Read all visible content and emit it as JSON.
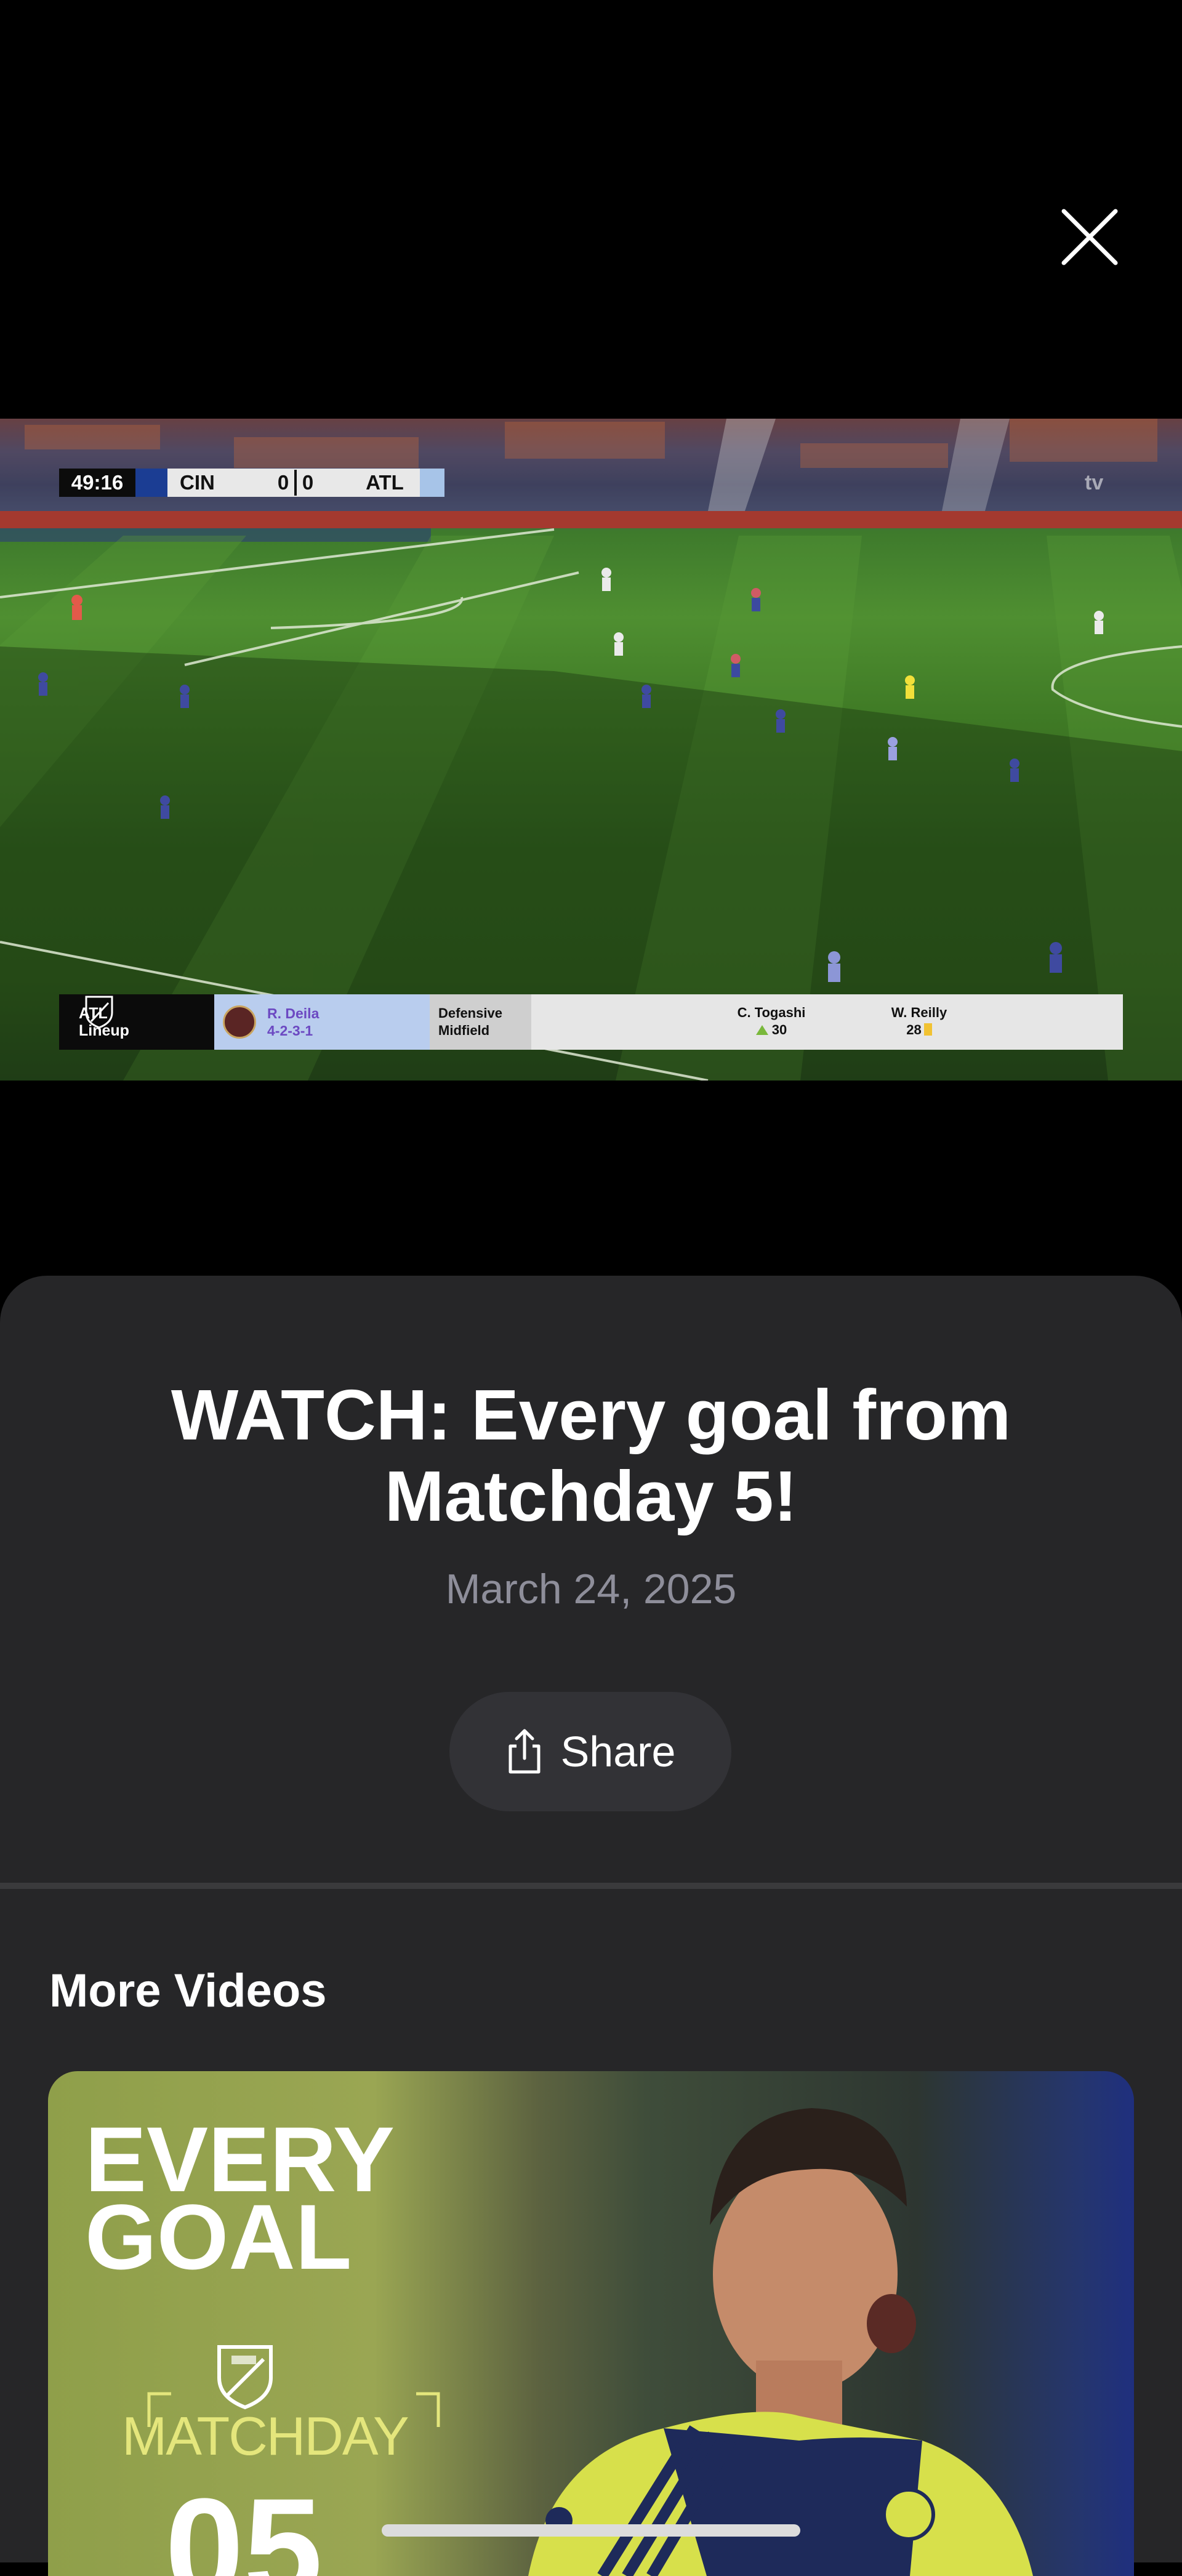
{
  "video": {
    "scoreboard": {
      "clock": "49:16",
      "home_team": "CIN",
      "home_score": "0",
      "away_score": "0",
      "away_team": "ATL"
    },
    "watermark": "tv",
    "lineup_graphic": {
      "title": "ATL\nLineup",
      "coach_name": "R. Deila",
      "formation": "4-2-3-1",
      "position": "Defensive\nMidfield",
      "players": [
        {
          "name": "C. Togashi",
          "number": "30",
          "marker": "green-triangle"
        },
        {
          "name": "W. Reilly",
          "number": "28",
          "marker": "yellow-card"
        }
      ]
    }
  },
  "details": {
    "title": "WATCH: Every goal from Matchday 5!",
    "date": "March 24, 2025",
    "share_label": "Share"
  },
  "more_videos": {
    "heading": "More Videos",
    "items": [
      {
        "line1": "EVERY",
        "line2": "GOAL",
        "subtitle": "MATCHDAY",
        "number": "05"
      }
    ]
  },
  "icons": {
    "close": "close-icon",
    "share": "share-icon",
    "mls": "mls-crest-icon"
  },
  "colors": {
    "background": "#000000",
    "sheet": "#262628",
    "share_button": "#323236",
    "date_text": "#8e8e9a"
  }
}
